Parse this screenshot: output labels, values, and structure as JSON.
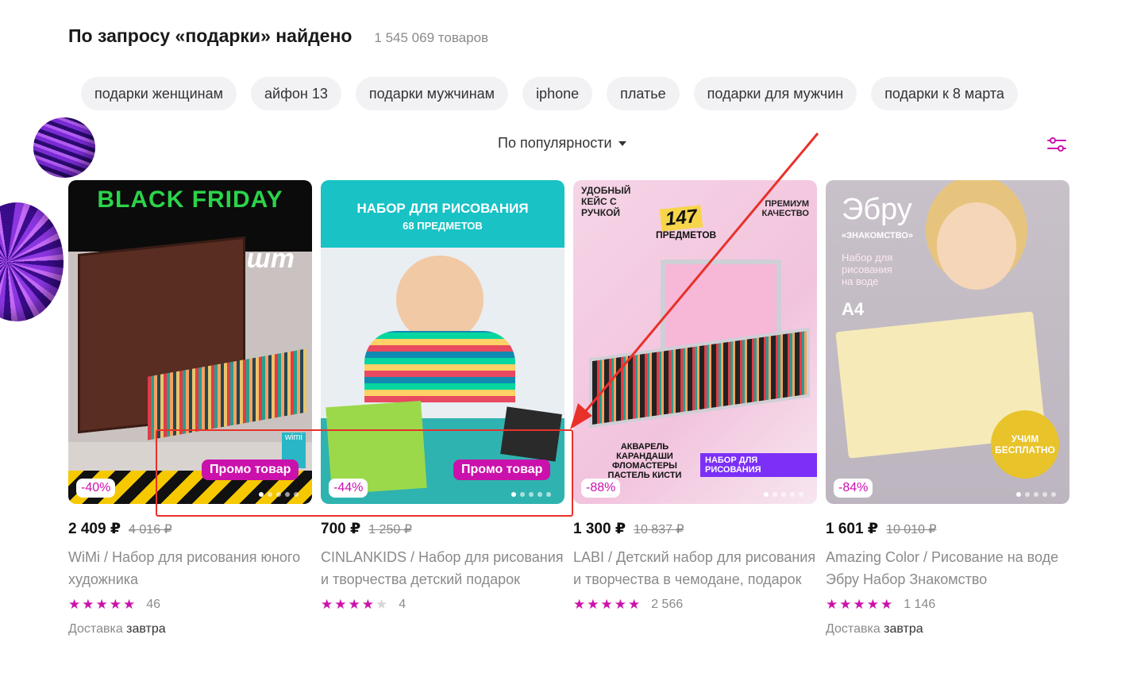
{
  "header": {
    "title": "По запросу «подарки» найдено",
    "count": "1 545 069 товаров"
  },
  "chips": [
    "подарки женщинам",
    "айфон 13",
    "подарки мужчинам",
    "iphone",
    "платье",
    "подарки для мужчин",
    "подарки к 8 марта"
  ],
  "sort": {
    "label": "По популярности"
  },
  "products": [
    {
      "price": "2 409 ₽",
      "old_price": "4 016 ₽",
      "name": "WiMi / Набор для рисования юного художника",
      "rating": 5,
      "reviews": "46",
      "discount": "-40%",
      "promo": "Промо товар",
      "delivery_label": "Доставка",
      "delivery_day": "завтра",
      "banner": "BLACK FRIDAY",
      "badge": "142 шт",
      "brand": "wimi"
    },
    {
      "price": "700 ₽",
      "old_price": "1 250 ₽",
      "name": "CINLANKIDS / Набор для рисования и творчества детский подарок",
      "rating": 4,
      "reviews": "4",
      "discount": "-44%",
      "promo": "Промо товар",
      "banner": "НАБОР ДЛЯ РИСОВАНИЯ",
      "sub": "68 ПРЕДМЕТОВ"
    },
    {
      "price": "1 300 ₽",
      "old_price": "10 837 ₽",
      "name": "LABI / Детский набор для рисования и творчества в чемодане, подарок",
      "rating": 5,
      "reviews": "2 566",
      "discount": "-88%",
      "banner": "УДОБНЫЙ КЕЙС С РУЧКОЙ",
      "badge": "147",
      "badge2": "ПРЕДМЕТОВ",
      "note": "ПРЕМИУМ КАЧЕСТВО",
      "items": "АКВАРЕЛЬ КАРАНДАШИ ФЛОМАСТЕРЫ ПАСТЕЛЬ КИСТИ",
      "tag": "НАБОР ДЛЯ РИСОВАНИЯ"
    },
    {
      "price": "1 601 ₽",
      "old_price": "10 010 ₽",
      "name": "Amazing Color / Рисование на воде Эбру Набор Знакомство",
      "rating": 5,
      "reviews": "1 146",
      "discount": "-84%",
      "delivery_label": "Доставка",
      "delivery_day": "завтра",
      "banner": "Эбру",
      "sub": "«ЗНАКОМСТВО»",
      "note": "Набор для рисования на воде",
      "badge": "А4",
      "tag": "УЧИМ БЕСПЛАТНО"
    }
  ],
  "colors": {
    "accent": "#cb11ab",
    "highlight": "#e8312a"
  }
}
